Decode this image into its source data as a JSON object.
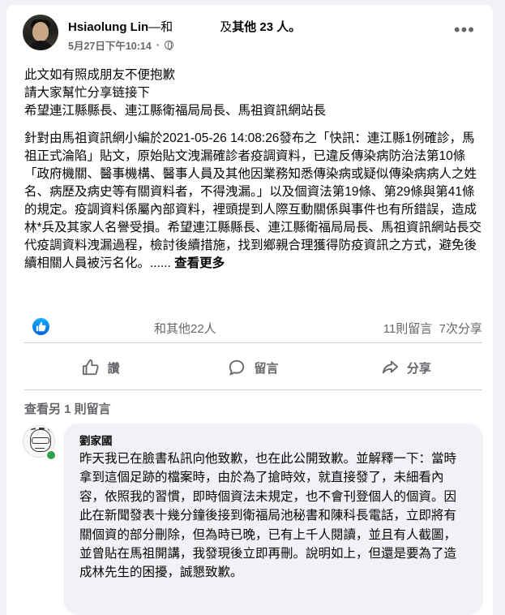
{
  "post": {
    "author": "Hsiaolung Lin",
    "with_connector": "—和",
    "and_others": "及",
    "others_count_label": "其他 23 人",
    "tail_char": "。",
    "timestamp": "5月27日下午10:14",
    "privacy_icon": "globe-icon",
    "more_icon": "more-horizontal-icon",
    "lines": [
      "此文如有照成朋友不便抱歉",
      "請大家幫忙分享链接下",
      "希望連江縣縣長、連江縣衛福局局長、馬祖資訊網站長"
    ],
    "paragraph": "針對由馬祖資訊網小編於2021-05-26 14:08:26發布之「快訊：連江縣1例確診，馬祖正式淪陷」貼文，原始貼文洩漏確診者疫調資料，已違反傳染病防治法第10條「政府機關、醫事機構、醫事人員及其他因業務知悉傳染病或疑似傳染病病人之姓名、病歷及病史等有關資料者，不得洩漏。」以及個資法第19條、第29條與第41條的規定。疫調資料係屬內部資料，裡頭提到人際互動關係與事件也有所錯誤，造成林*兵及其家人名譽受損。希望連江縣縣長、連江縣衛福局局長、馬祖資訊網站長交代疫調資料洩漏過程，檢討後續措施，找到鄉親合理獲得防疫資訊之方式，避免後續相關人員被污名化。......",
    "see_more": "查看更多"
  },
  "stats": {
    "reactions_others": "和其他22人",
    "comments": "11則留言",
    "shares": "7次分享",
    "colors": {
      "like": "#1877f2"
    }
  },
  "actions": {
    "like": "讚",
    "comment": "留言",
    "share": "分享"
  },
  "comments": {
    "view_more": "查看另 1 則留言",
    "items": [
      {
        "name": "劉家國",
        "text": "昨天我已在臉書私訊向他致歉，也在此公開致歉。並解釋一下：當時拿到這個足跡的檔案時，由於為了搶時效，就直接發了，未細看內容，依照我的習慣，即時個資法未規定，也不會刊登個人的個資。因此在新聞發表十幾分鐘後接到衛福局池秘書和陳科長電話，立即將有關個資的部分刪除，但為時已晚，已有上千人閱讀，並且有人截圖，並曾貼在馬祖開講，我發現後立即再刪。說明如上，但還是要為了造成林先生的困擾，誠懇致歉。"
      }
    ]
  }
}
